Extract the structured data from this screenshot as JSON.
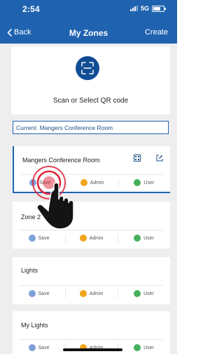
{
  "status_bar": {
    "time": "2:54",
    "network": "5G"
  },
  "nav": {
    "back_label": "Back",
    "title": "My Zones",
    "create_label": "Create"
  },
  "scan": {
    "icon": "qr-scan-icon",
    "label": "Scan or Select QR code"
  },
  "current": {
    "prefix": "Current:",
    "value": "Mangers Conference Room"
  },
  "zones": [
    {
      "name": "Mangers Conference Room",
      "selected": true,
      "icons": [
        "qr-code-icon",
        "edit-icon"
      ]
    },
    {
      "name": "Zone 2"
    },
    {
      "name": "Lights"
    },
    {
      "name": "My Lights"
    }
  ],
  "actions": {
    "save": "Save",
    "admin": "Admin",
    "user": "User"
  },
  "colors": {
    "header_blue": "#1f63b0",
    "save_blue": "#7ea0d9",
    "admin_orange": "#efa61c",
    "user_green": "#45b05b",
    "tap_indicator_red": "#e0263b"
  },
  "overlay": {
    "icon": "tap-gesture-hand-icon"
  }
}
